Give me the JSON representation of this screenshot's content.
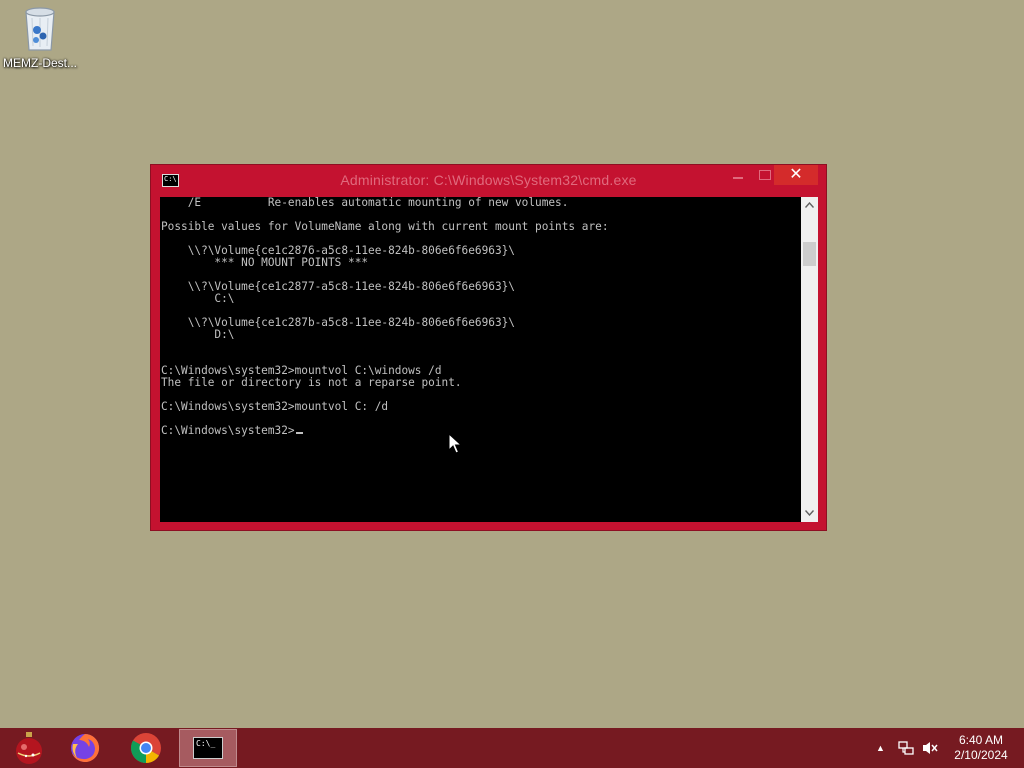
{
  "desktop": {
    "icons": [
      {
        "label": "MEMZ-Dest..."
      }
    ]
  },
  "window": {
    "title": "Administrator: C:\\Windows\\System32\\cmd.exe",
    "icon_text": "C:\\",
    "close_glyph": "✕",
    "console_lines": [
      "    /E          Re-enables automatic mounting of new volumes.",
      "",
      "Possible values for VolumeName along with current mount points are:",
      "",
      "    \\\\?\\Volume{ce1c2876-a5c8-11ee-824b-806e6f6e6963}\\",
      "        *** NO MOUNT POINTS ***",
      "",
      "    \\\\?\\Volume{ce1c2877-a5c8-11ee-824b-806e6f6e6963}\\",
      "        C:\\",
      "",
      "    \\\\?\\Volume{ce1c287b-a5c8-11ee-824b-806e6f6e6963}\\",
      "        D:\\",
      "",
      "",
      "C:\\Windows\\system32>mountvol C:\\windows /d",
      "The file or directory is not a reparse point.",
      "",
      "C:\\Windows\\system32>mountvol C: /d",
      "",
      "C:\\Windows\\system32>"
    ]
  },
  "taskbar": {
    "buttons": [
      {
        "name": "start",
        "icon": "ornament-icon"
      },
      {
        "name": "firefox",
        "icon": "firefox-icon"
      },
      {
        "name": "chrome",
        "icon": "chrome-icon"
      },
      {
        "name": "cmd",
        "icon": "cmd-icon",
        "icon_text": "C:\\_"
      }
    ],
    "tray": {
      "arrow": "▲",
      "time": "6:40 AM",
      "date": "2/10/2024"
    }
  },
  "colors": {
    "desktop": "#ada786",
    "window_frame": "#c41230",
    "close_button": "#d42b2b",
    "taskbar": "#761a21",
    "console_text": "#c0c0c0"
  }
}
